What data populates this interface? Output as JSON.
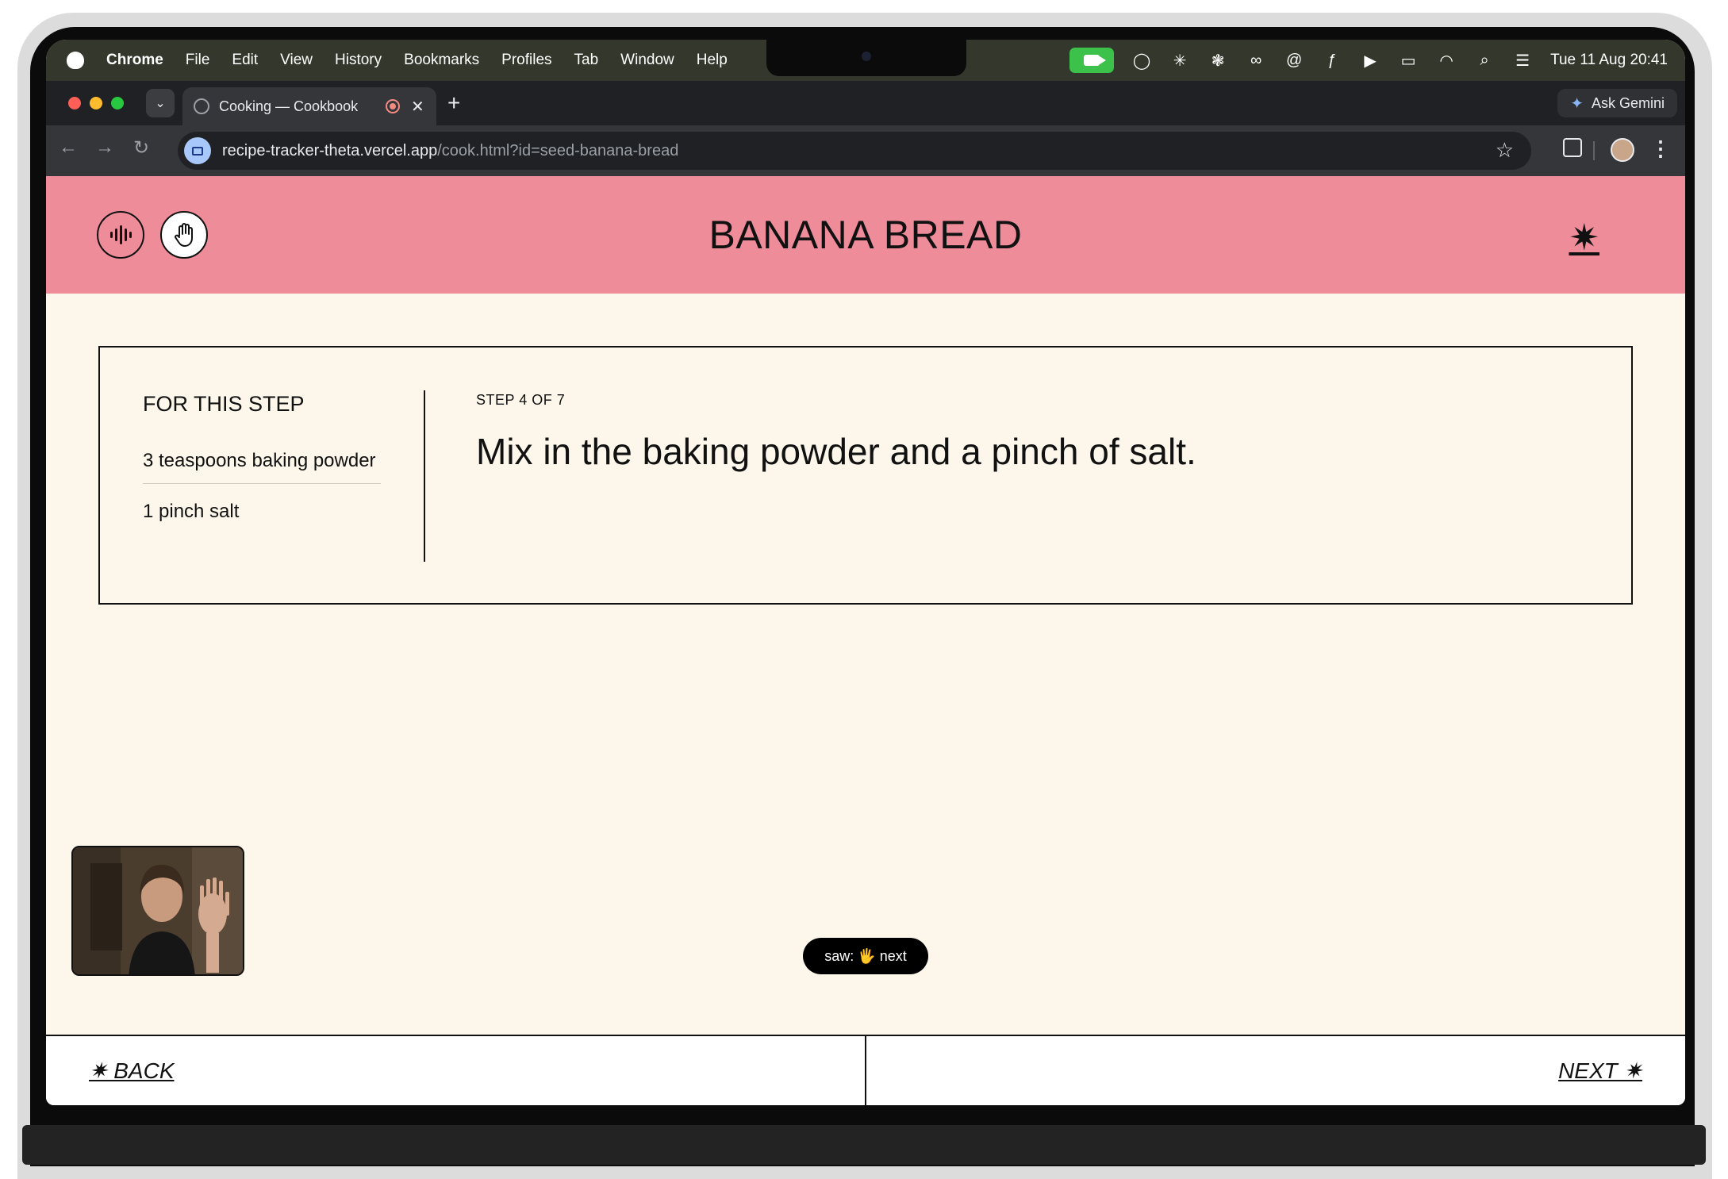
{
  "menubar": {
    "app": "Chrome",
    "items": [
      "File",
      "Edit",
      "View",
      "History",
      "Bookmarks",
      "Profiles",
      "Tab",
      "Window",
      "Help"
    ],
    "clock": "Tue 11 Aug  20:41"
  },
  "browser": {
    "tab_title": "Cooking — Cookbook",
    "url_host": "recipe-tracker-theta.vercel.app",
    "url_path": "/cook.html?id=seed-banana-bread",
    "gemini_label": "Ask Gemini"
  },
  "app": {
    "title": "BANANA BREAD",
    "ingredients_heading": "FOR THIS STEP",
    "ingredients": [
      {
        "text": "3 teaspoons baking powder"
      },
      {
        "text": "1 pinch salt"
      }
    ],
    "step_label": "STEP 4 OF 7",
    "step_text": "Mix in the baking powder and a pinch of salt.",
    "gesture_status": "saw: 🖐 next",
    "back_label": "✷  BACK",
    "next_label": "NEXT  ✷",
    "accent_color": "#ee8c9a",
    "background_color": "#fcf7ea"
  }
}
